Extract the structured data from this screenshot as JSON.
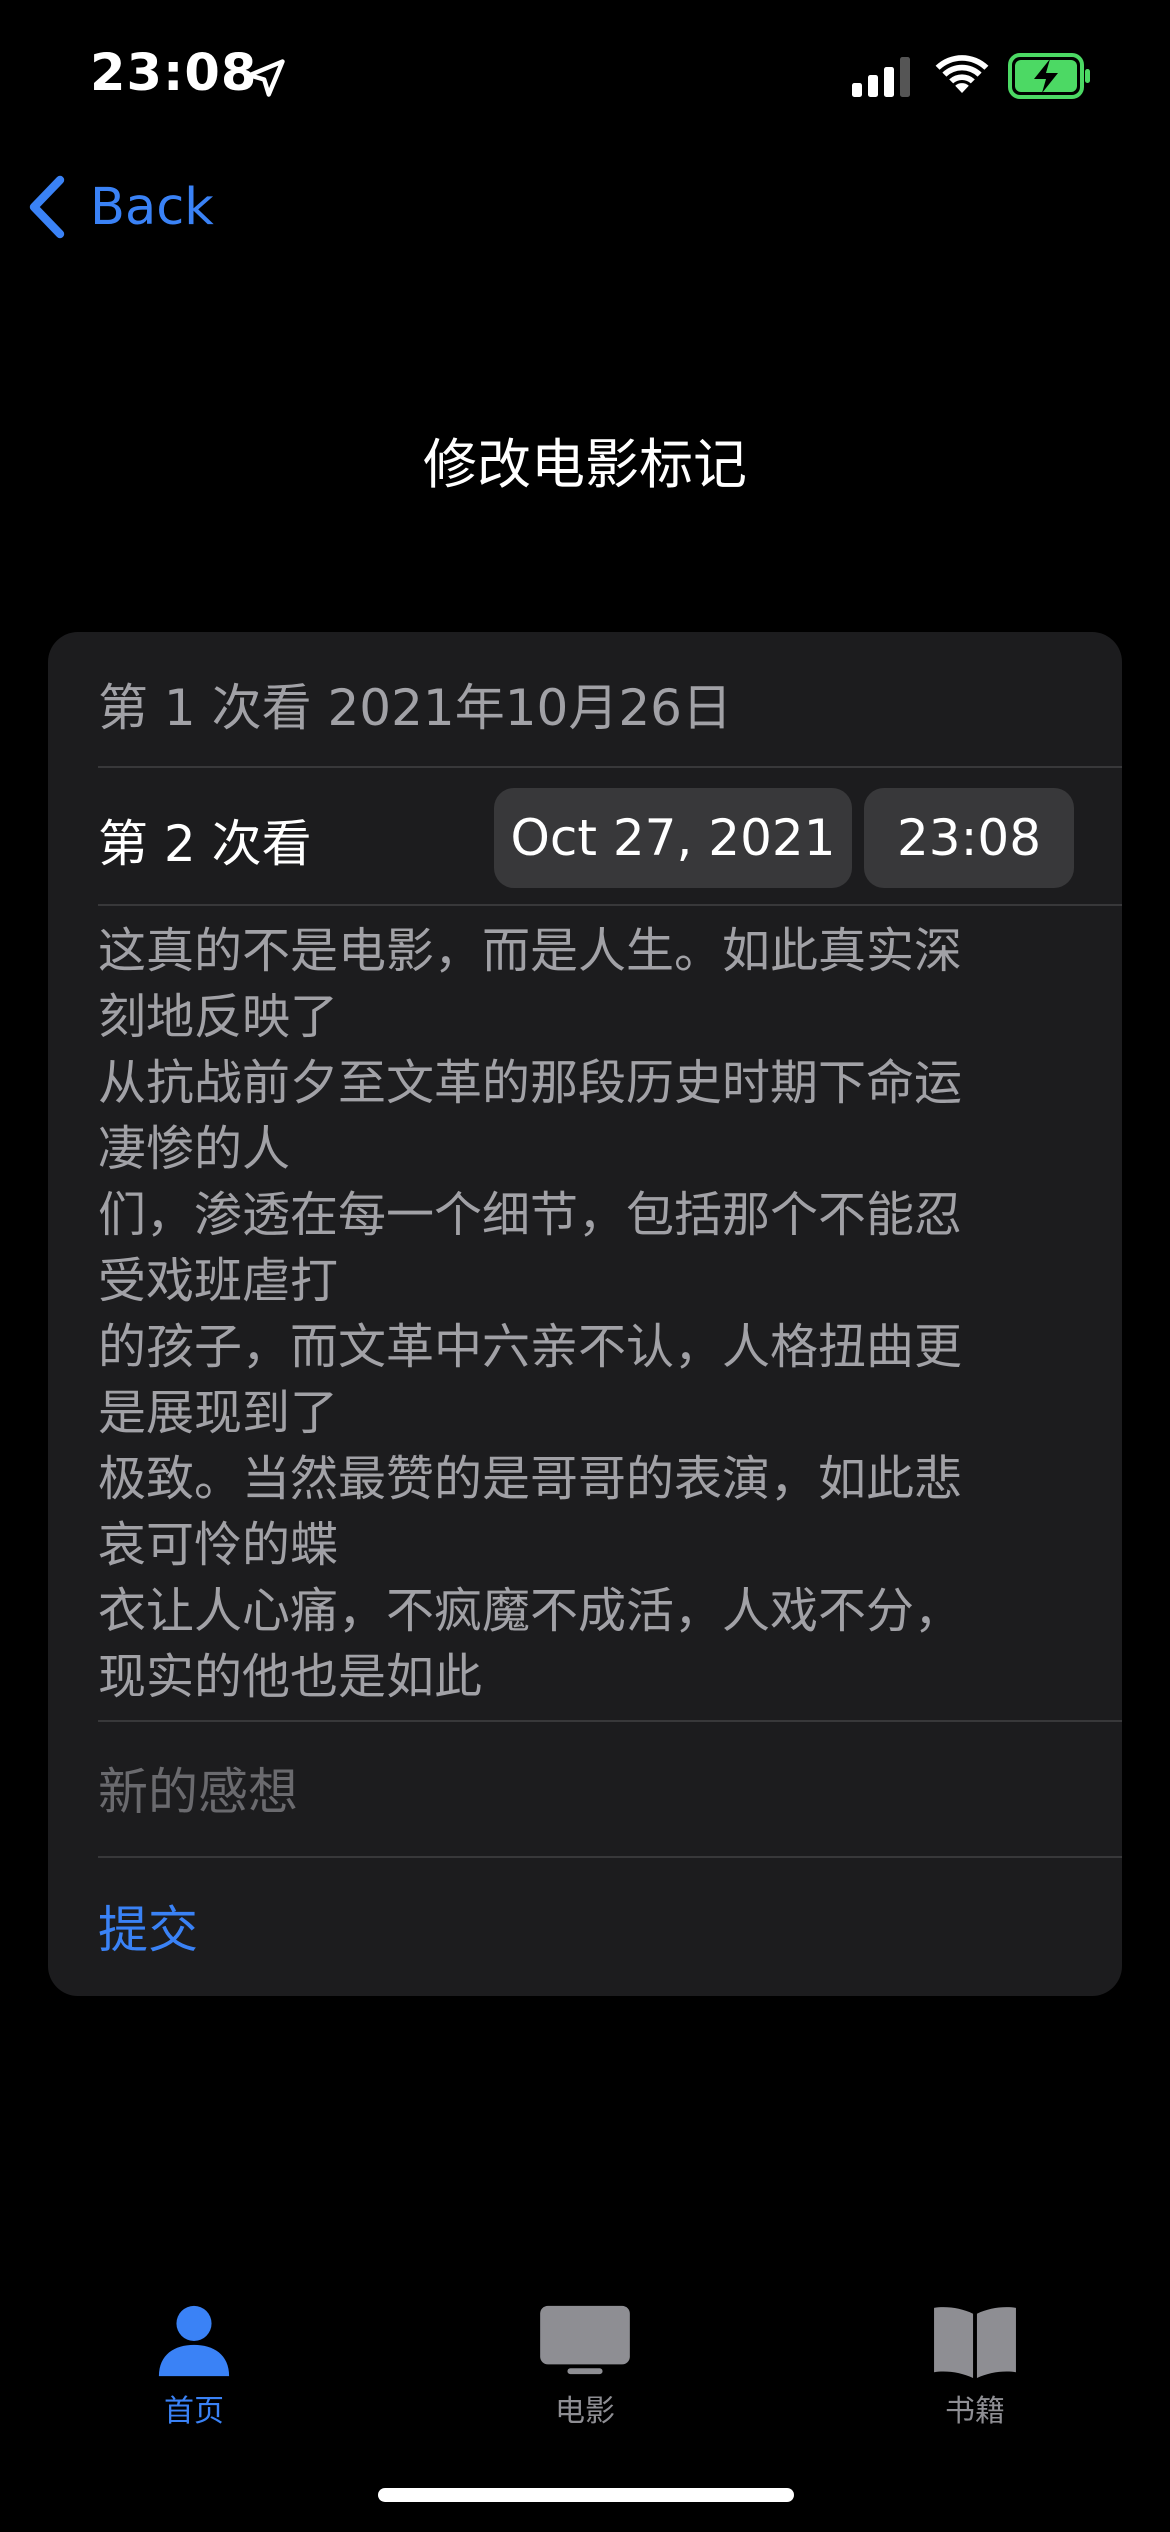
{
  "status_bar": {
    "time": "23:08",
    "icons": [
      "location-arrow-icon",
      "cellular-signal-icon",
      "wifi-icon",
      "battery-charging-icon"
    ],
    "battery_color": "#4cd964"
  },
  "nav": {
    "back_label": "Back"
  },
  "page": {
    "title": "修改电影标记"
  },
  "form": {
    "first_watch": "第 1 次看  2021年10月26日",
    "second_watch_label": "第 2 次看",
    "second_watch_date": "Oct 27, 2021",
    "second_watch_time": "23:08",
    "review_lines": [
      "这真的不是电影，而是人生。如此真实深",
      "刻地反映了",
      "从抗战前夕至文革的那段历史时期下命运",
      "凄惨的人",
      "们，渗透在每一个细节，包括那个不能忍",
      "受戏班虐打",
      "的孩子，而文革中六亲不认，人格扭曲更",
      "是展现到了",
      "极致。当然最赞的是哥哥的表演，如此悲",
      "哀可怜的蝶",
      "衣让人心痛，不疯魔不成活，人戏不分，",
      "现实的他也是如此"
    ],
    "new_thought_placeholder": "新的感想",
    "submit_label": "提交"
  },
  "tab_bar": {
    "tabs": [
      {
        "label": "首页",
        "icon": "person-icon",
        "active": true
      },
      {
        "label": "电影",
        "icon": "tv-icon",
        "active": false
      },
      {
        "label": "书籍",
        "icon": "book-icon",
        "active": false
      }
    ],
    "active_color": "#3a82f6",
    "inactive_color": "#8e8e93"
  },
  "colors": {
    "accent": "#3a82f6",
    "card_background": "#1c1c1e",
    "pill_background": "#38383a"
  }
}
